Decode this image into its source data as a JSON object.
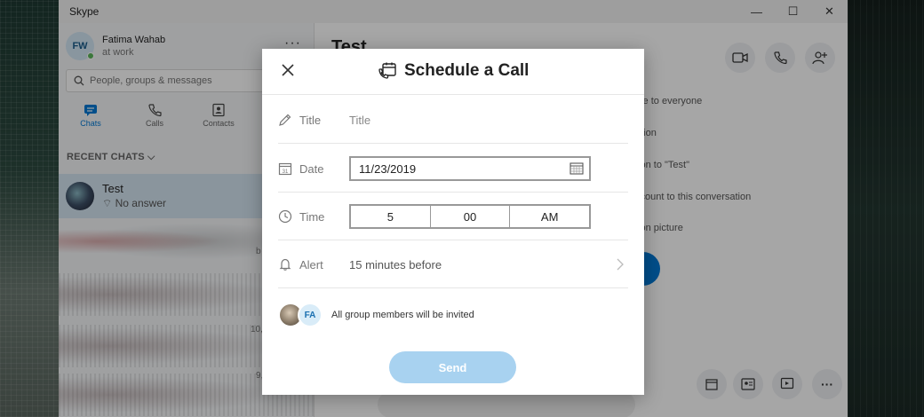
{
  "window": {
    "title": "Skype",
    "controls": {
      "minimize": "—",
      "maximize": "☐",
      "close": "✕"
    }
  },
  "sidebar": {
    "profile": {
      "initials": "FW",
      "name": "Fatima Wahab",
      "status": "at work"
    },
    "more": "···",
    "search": {
      "placeholder": "People, groups & messages"
    },
    "tabs": [
      {
        "label": "Chats",
        "active": true
      },
      {
        "label": "Calls"
      },
      {
        "label": "Contacts"
      }
    ],
    "recent_label": "RECENT CHATS",
    "chats": [
      {
        "name": "Test",
        "preview": "No answer"
      }
    ],
    "side_numbers": [
      "b",
      "10,",
      "9,"
    ]
  },
  "main": {
    "conversation_title": "Test",
    "info_lines": [
      "ble to everyone",
      "ation",
      "tion to \"Test\"",
      "ccount to this conversation",
      "tion picture"
    ]
  },
  "dialog": {
    "title": "Schedule a Call",
    "fields": {
      "title": {
        "label": "Title",
        "placeholder": "Title",
        "value": ""
      },
      "date": {
        "label": "Date",
        "value": "11/23/2019"
      },
      "time": {
        "label": "Time",
        "hour": "5",
        "minute": "00",
        "period": "AM"
      },
      "alert": {
        "label": "Alert",
        "value": "15 minutes before"
      }
    },
    "members": {
      "initials": "FA",
      "text": "All group members will be invited"
    },
    "send_label": "Send"
  },
  "colors": {
    "accent": "#0078d4",
    "send_disabled": "#a8d2f0",
    "selected_chat": "#d5e5f1"
  }
}
